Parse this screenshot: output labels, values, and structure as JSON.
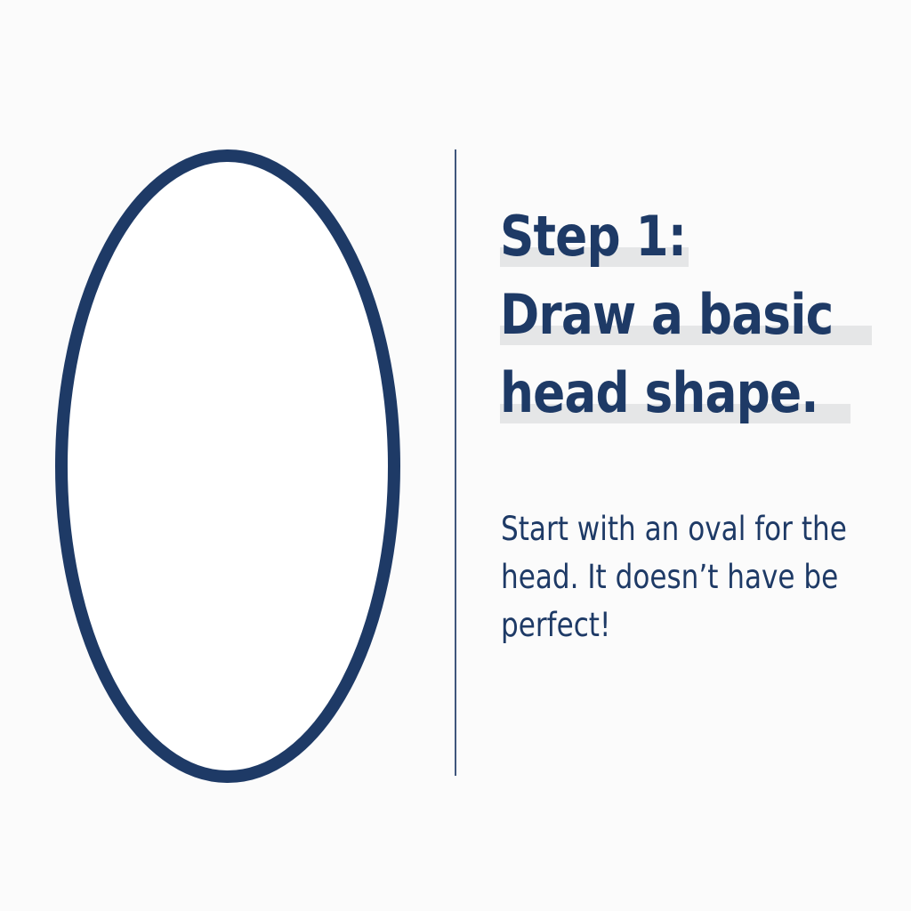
{
  "colors": {
    "background": "#fbfbfb",
    "accent": "#1e3a66",
    "highlight": "#e5e6e7"
  },
  "illustration": {
    "icon": "oval-outline",
    "description_visible": false
  },
  "step": {
    "heading_lines": [
      "Step 1:",
      "Draw a basic",
      "head shape."
    ],
    "body_lines": [
      "Start with an oval for the",
      "head. It doesn’t have be",
      "perfect!"
    ]
  }
}
